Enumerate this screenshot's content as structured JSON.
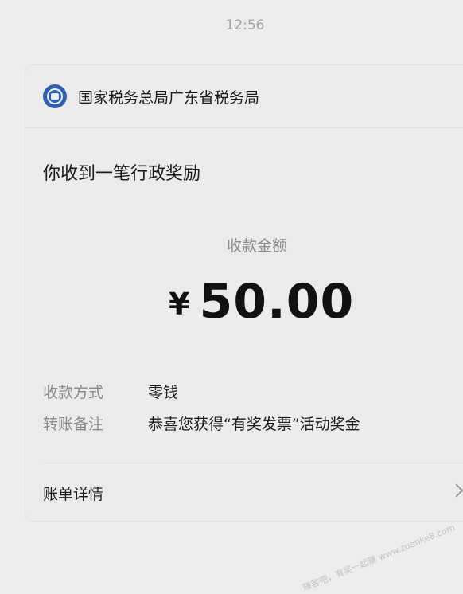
{
  "timestamp": "12:56",
  "card": {
    "sender": "国家税务总局广东省税务局",
    "title": "你收到一笔行政奖励",
    "amount_label": "收款金额",
    "currency_symbol": "¥",
    "amount": "50.00",
    "rows": [
      {
        "key": "收款方式",
        "value": "零钱"
      },
      {
        "key": "转账备注",
        "value": "恭喜您获得“有奖发票”活动奖金"
      }
    ],
    "details_label": "账单详情"
  },
  "watermark": "赚客吧，有奖一起赚 www.zuanke8.com",
  "icons": {
    "sender_logo": "tax-bureau-logo-icon",
    "chevron": "chevron-right-icon"
  },
  "colors": {
    "background": "#ededed",
    "card": "#ebebeb",
    "muted_text": "#8a8a8a",
    "logo_blue": "#2f5fb3"
  }
}
